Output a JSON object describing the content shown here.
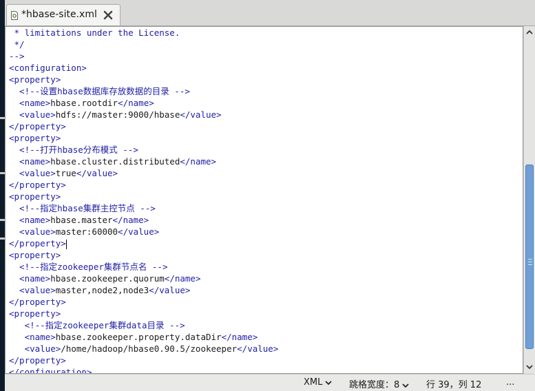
{
  "tab": {
    "title": "*hbase-site.xml",
    "icon": "xml-file-icon",
    "close_icon": "close-icon"
  },
  "editor": {
    "lines": [
      [
        {
          "t": "cmt",
          "v": " * limitations under the License."
        }
      ],
      [
        {
          "t": "cmt",
          "v": " */"
        }
      ],
      [
        {
          "t": "cmt",
          "v": "-->"
        }
      ],
      [
        {
          "t": "tag",
          "v": "<configuration>"
        }
      ],
      [
        {
          "t": "tag",
          "v": "<property>"
        }
      ],
      [
        {
          "t": "cmt",
          "v": "  <!--设置hbase数据库存放数据的目录 -->"
        }
      ],
      [
        {
          "t": "tag",
          "v": "  <name>"
        },
        {
          "t": "txt",
          "v": "hbase.rootdir"
        },
        {
          "t": "tag",
          "v": "</name>"
        }
      ],
      [
        {
          "t": "tag",
          "v": "  <value>"
        },
        {
          "t": "txt",
          "v": "hdfs://master:9000/hbase"
        },
        {
          "t": "tag",
          "v": "</value>"
        }
      ],
      [
        {
          "t": "tag",
          "v": "</property>"
        }
      ],
      [
        {
          "t": "tag",
          "v": "<property>"
        }
      ],
      [
        {
          "t": "cmt",
          "v": "  <!--打开hbase分布模式 -->"
        }
      ],
      [
        {
          "t": "tag",
          "v": "  <name>"
        },
        {
          "t": "txt",
          "v": "hbase.cluster.distributed"
        },
        {
          "t": "tag",
          "v": "</name>"
        }
      ],
      [
        {
          "t": "tag",
          "v": "  <value>"
        },
        {
          "t": "txt",
          "v": "true"
        },
        {
          "t": "tag",
          "v": "</value>"
        }
      ],
      [
        {
          "t": "tag",
          "v": "</property>"
        }
      ],
      [
        {
          "t": "tag",
          "v": "<property>"
        }
      ],
      [
        {
          "t": "cmt",
          "v": "  <!--指定hbase集群主控节点 -->"
        }
      ],
      [
        {
          "t": "tag",
          "v": "  <name>"
        },
        {
          "t": "txt",
          "v": "hbase.master"
        },
        {
          "t": "tag",
          "v": "</name>"
        }
      ],
      [
        {
          "t": "tag",
          "v": "  <value>"
        },
        {
          "t": "txt",
          "v": "master:60000"
        },
        {
          "t": "tag",
          "v": "</value>"
        }
      ],
      [
        {
          "t": "tag",
          "v": "</property>"
        },
        {
          "t": "caret",
          "v": ""
        }
      ],
      [
        {
          "t": "tag",
          "v": "<property>"
        }
      ],
      [
        {
          "t": "cmt",
          "v": "  <!--指定zookeeper集群节点名 -->"
        }
      ],
      [
        {
          "t": "tag",
          "v": "  <name>"
        },
        {
          "t": "txt",
          "v": "hbase.zookeeper.quorum"
        },
        {
          "t": "tag",
          "v": "</name>"
        }
      ],
      [
        {
          "t": "tag",
          "v": "  <value>"
        },
        {
          "t": "txt",
          "v": "master,node2,node3"
        },
        {
          "t": "tag",
          "v": "</value>"
        }
      ],
      [
        {
          "t": "tag",
          "v": "</property>"
        }
      ],
      [
        {
          "t": "tag",
          "v": "<property>"
        }
      ],
      [
        {
          "t": "cmt",
          "v": "   <!--指定zookeeper集群data目录 -->"
        }
      ],
      [
        {
          "t": "tag",
          "v": "   <name>"
        },
        {
          "t": "txt",
          "v": "hbase.zookeeper.property.dataDir"
        },
        {
          "t": "tag",
          "v": "</name>"
        }
      ],
      [
        {
          "t": "tag",
          "v": "   <value>"
        },
        {
          "t": "txt",
          "v": "/home/hadoop/hbase0.90.5/zookeeper"
        },
        {
          "t": "tag",
          "v": "</value>"
        }
      ],
      [
        {
          "t": "tag",
          "v": "</property>"
        }
      ],
      [
        {
          "t": "tag",
          "v": "</configuration>"
        }
      ]
    ]
  },
  "status": {
    "language": "XML",
    "tab_width_label": "跳格宽度：",
    "tab_width_value": "8",
    "cursor_position": "行 39，列 12",
    "more": "..."
  },
  "colors": {
    "tag": "#2020a8",
    "text": "#1b1b1b",
    "scroll_thumb": "#6f9fd6"
  },
  "scroll": {
    "thumb_start": 0.39,
    "thumb_extent": 0.57
  }
}
